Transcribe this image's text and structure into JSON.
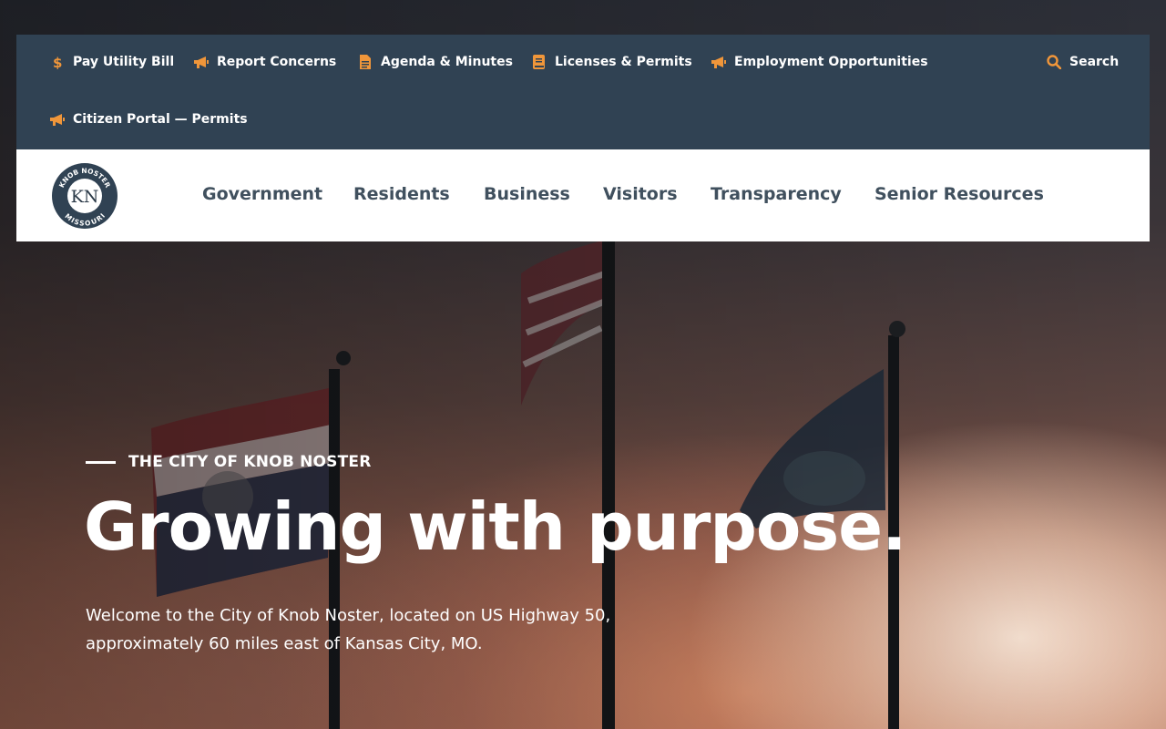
{
  "utility_bar": {
    "items": [
      {
        "label": "Pay Utility Bill",
        "icon": "dollar-icon"
      },
      {
        "label": "Report Concerns",
        "icon": "megaphone-icon"
      },
      {
        "label": "Agenda & Minutes",
        "icon": "document-icon"
      },
      {
        "label": "Licenses & Permits",
        "icon": "book-icon"
      },
      {
        "label": "Employment Opportunities",
        "icon": "megaphone-icon"
      },
      {
        "label": "Citizen Portal — Permits",
        "icon": "megaphone-icon"
      }
    ],
    "search_label": "Search",
    "accent_color": "#f0963a",
    "background_color": "#304253"
  },
  "logo": {
    "top_text": "KNOB NOSTER",
    "monogram": "KN",
    "bottom_text": "MISSOURI"
  },
  "main_nav": {
    "items": [
      "Government",
      "Residents",
      "Business",
      "Visitors",
      "Transparency",
      "Senior Resources"
    ]
  },
  "hero": {
    "eyebrow": "THE CITY OF KNOB NOSTER",
    "headline": "Growing with purpose.",
    "intro_line_1": "Welcome to the City of Knob Noster, located on US Highway 50,",
    "intro_line_2": "approximately 60 miles east of Kansas City, MO."
  }
}
